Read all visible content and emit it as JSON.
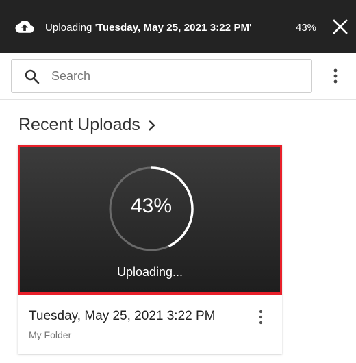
{
  "topbar": {
    "prefix": "Uploading '",
    "file_name": "Tuesday, May 25, 2021 3:22 PM",
    "suffix": "'",
    "progress_percent_text": "43%",
    "close_icon": "close-icon",
    "cloud_icon": "cloud-upload-icon"
  },
  "search": {
    "placeholder": "Search",
    "value": "",
    "icon": "search-icon"
  },
  "overflow_menu_icon": "more-vert-icon",
  "recent": {
    "title": "Recent Uploads",
    "chevron_icon": "chevron-right-icon"
  },
  "card": {
    "progress_percent": 43,
    "progress_text": "43%",
    "status_text": "Uploading...",
    "title": "Tuesday, May 25, 2021 3:22 PM",
    "folder": "My Folder",
    "highlight_color": "#e8202a"
  }
}
